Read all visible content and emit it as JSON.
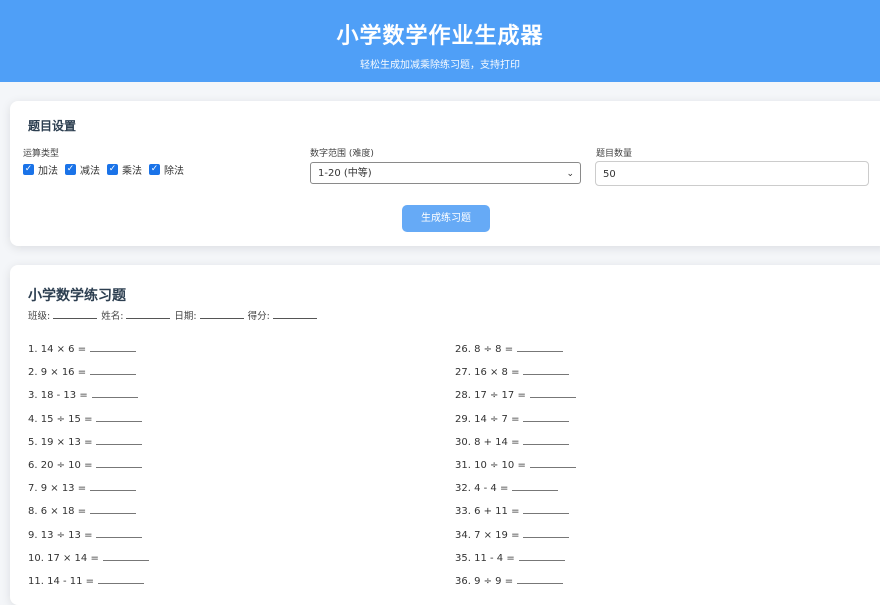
{
  "header": {
    "title": "小学数学作业生成器",
    "subtitle": "轻松生成加减乘除练习题，支持打印"
  },
  "settings": {
    "title": "题目设置",
    "operation_label": "运算类型",
    "operations": [
      {
        "label": "加法",
        "checked": true
      },
      {
        "label": "减法",
        "checked": true
      },
      {
        "label": "乘法",
        "checked": true
      },
      {
        "label": "除法",
        "checked": true
      }
    ],
    "range_label": "数字范围 (难度)",
    "range_value": "1-20 (中等)",
    "count_label": "题目数量",
    "count_value": "50",
    "generate_label": "生成练习题"
  },
  "sheet": {
    "title": "小学数学练习题",
    "info": {
      "class_label": "班级:",
      "name_label": "姓名:",
      "date_label": "日期:",
      "score_label": "得分:"
    },
    "left_problems": [
      "1. 14 × 6 =",
      "2. 9 × 16 =",
      "3. 18 - 13 =",
      "4. 15 ÷ 15 =",
      "5. 19 × 13 =",
      "6. 20 ÷ 10 =",
      "7. 9 × 13 =",
      "8. 6 × 18 =",
      "9. 13 ÷ 13 =",
      "10. 17 × 14 =",
      "11. 14 - 11 ="
    ],
    "right_problems": [
      "26. 8 ÷ 8 =",
      "27. 16 × 8 =",
      "28. 17 ÷ 17 =",
      "29. 14 ÷ 7 =",
      "30. 8 + 14 =",
      "31. 10 ÷ 10 =",
      "32. 4 - 4 =",
      "33. 6 + 11 =",
      "34. 7 × 19 =",
      "35. 11 - 4 =",
      "36. 9 ÷ 9 ="
    ]
  },
  "colors": {
    "header_bg": "#4f9ff7",
    "button_bg": "#66aaf6",
    "checkbox": "#1a73e8"
  }
}
